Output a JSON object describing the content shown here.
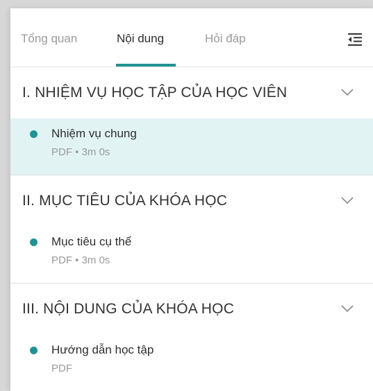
{
  "tabs": [
    {
      "label": "Tổng quan"
    },
    {
      "label": "Nội dung"
    },
    {
      "label": "Hỏi đáp"
    }
  ],
  "active_tab": "Nội dung",
  "menu_icon": "collapse-list-icon",
  "sections": [
    {
      "title": "I. NHIỆM VỤ HỌC TẬP CỦA HỌC VIÊN",
      "lesson": {
        "title": "Nhiệm vụ chung",
        "meta": "PDF • 3m 0s",
        "active": true
      }
    },
    {
      "title": "II. MỤC TIÊU CỦA KHÓA HỌC",
      "lesson": {
        "title": "Mục tiêu cụ thể",
        "meta": "PDF • 3m 0s",
        "active": false
      }
    },
    {
      "title": "III. NỘI DUNG CỦA KHÓA HỌC",
      "lesson": {
        "title": "Hướng dẫn học tập",
        "meta": "PDF",
        "active": false
      }
    }
  ],
  "colors": {
    "accent": "#1a9494",
    "active_row_bg": "#e2f3f3",
    "muted_text": "#9a9a9a",
    "text": "#2d2d2d"
  }
}
